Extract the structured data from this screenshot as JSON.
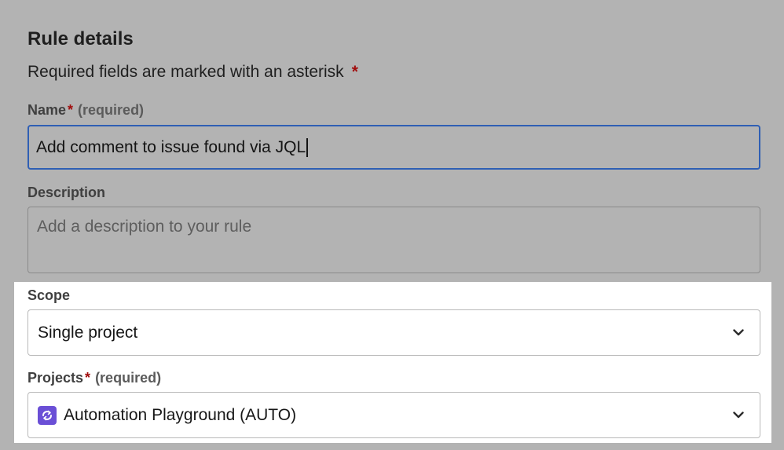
{
  "form": {
    "title": "Rule details",
    "required_note": "Required fields are marked with an asterisk",
    "asterisk": "*",
    "name": {
      "label": "Name",
      "required_text": "(required)",
      "value": "Add comment to issue found via JQL"
    },
    "description": {
      "label": "Description",
      "placeholder": "Add a description to your rule"
    },
    "scope": {
      "label": "Scope",
      "selected": "Single project"
    },
    "projects": {
      "label": "Projects",
      "required_text": "(required)",
      "selected": "Automation Playground (AUTO)",
      "icon": "project-avatar-icon"
    }
  },
  "colors": {
    "overlay": "#b3b3b3",
    "focus_border": "#2f5fb4",
    "required_asterisk": "#a10d0d",
    "project_icon": "#6a4fd6"
  }
}
